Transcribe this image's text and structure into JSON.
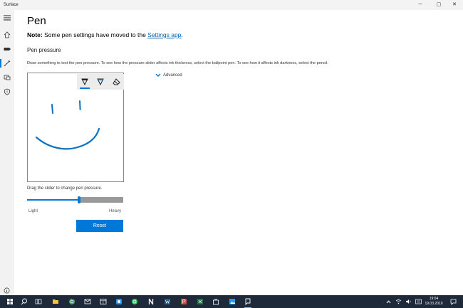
{
  "window": {
    "title": "Surface"
  },
  "window_controls": {
    "minimize": "─",
    "maximize": "▢",
    "close": "✕"
  },
  "sidebar": {
    "items": [
      {
        "icon": "hamburger-icon"
      },
      {
        "icon": "home-icon"
      },
      {
        "icon": "battery-icon"
      },
      {
        "icon": "pen-icon",
        "active": true
      },
      {
        "icon": "devices-icon"
      },
      {
        "icon": "shield-icon"
      }
    ],
    "footer_icon": "info-icon"
  },
  "page": {
    "title": "Pen",
    "note_label": "Note:",
    "note_text": " Some pen settings have moved to the ",
    "note_link": "Settings app",
    "note_end": ".",
    "section_title": "Pen pressure",
    "description": "Draw something to test the pen pressure. To see how the pressure slider affects ink thickness, select the ballpoint pen. To see how it affects ink darkness, select the pencil.",
    "advanced_label": "Advanced",
    "tools": [
      {
        "icon": "ballpoint-pen-icon",
        "selected": true
      },
      {
        "icon": "pencil-icon",
        "selected": false
      },
      {
        "icon": "eraser-icon",
        "selected": false
      }
    ],
    "slider_label": "Drag the slider to change pen pressure.",
    "slider_value": 0.54,
    "slider_min_label": "Light",
    "slider_max_label": "Heavy",
    "reset_label": "Reset"
  },
  "taskbar": {
    "items": [
      {
        "icon": "start-icon",
        "color": "#ffffff"
      },
      {
        "icon": "search-icon",
        "color": "#ffffff"
      },
      {
        "icon": "task-view-icon",
        "color": "#ffffff"
      },
      {
        "icon": "file-explorer-icon",
        "color": "#f4c542"
      },
      {
        "icon": "chrome-icon",
        "color": "#4caf50"
      },
      {
        "icon": "mail-icon",
        "color": "#ffffff"
      },
      {
        "icon": "calendar-icon",
        "color": "#ffffff"
      },
      {
        "icon": "messenger-icon",
        "color": "#2196f3"
      },
      {
        "icon": "whatsapp-icon",
        "color": "#25d366"
      },
      {
        "icon": "netflix-icon",
        "color": "#ffffff"
      },
      {
        "icon": "word-icon",
        "color": "#2b579a"
      },
      {
        "icon": "powerpoint-icon",
        "color": "#d24726"
      },
      {
        "icon": "excel-icon",
        "color": "#217346"
      },
      {
        "icon": "store-icon",
        "color": "#ffffff"
      },
      {
        "icon": "photos-icon",
        "color": "#2196f3"
      },
      {
        "icon": "surface-app-icon",
        "color": "#ffffff",
        "running": true
      }
    ],
    "tray_icons": [
      "chevron-up-icon",
      "wifi-icon",
      "volume-icon",
      "language-icon"
    ],
    "time": "19:04",
    "date": "19.03.2019",
    "notification_icon": "action-center-icon"
  },
  "colors": {
    "accent": "#0078d7",
    "taskbar": "#1e2a3a",
    "ink": "#1070c0"
  }
}
